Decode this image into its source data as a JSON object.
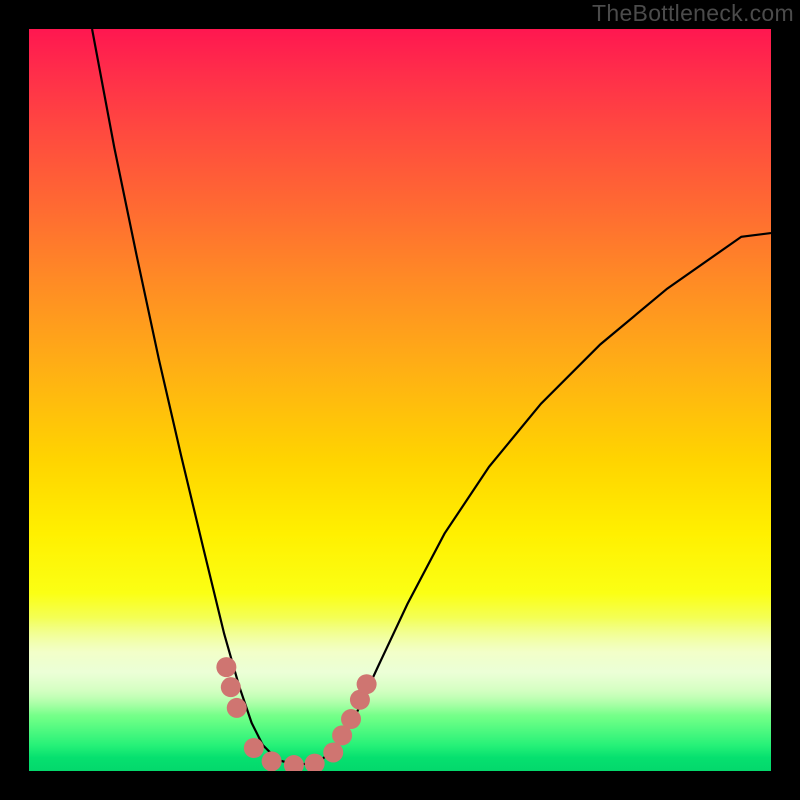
{
  "watermark": "TheBottleneck.com",
  "chart_data": {
    "type": "line",
    "title": "",
    "xlabel": "",
    "ylabel": "",
    "xlim": [
      0,
      1
    ],
    "ylim": [
      0,
      1
    ],
    "series": [
      {
        "name": "bottleneck-curve",
        "x": [
          0.085,
          0.115,
          0.145,
          0.175,
          0.205,
          0.235,
          0.263,
          0.283,
          0.3,
          0.315,
          0.335,
          0.36,
          0.39,
          0.41,
          0.44,
          0.47,
          0.51,
          0.56,
          0.62,
          0.69,
          0.77,
          0.86,
          0.96,
          1.0
        ],
        "y": [
          1.0,
          0.84,
          0.695,
          0.555,
          0.425,
          0.3,
          0.185,
          0.115,
          0.065,
          0.035,
          0.015,
          0.008,
          0.012,
          0.028,
          0.075,
          0.14,
          0.225,
          0.32,
          0.41,
          0.495,
          0.575,
          0.65,
          0.72,
          0.725
        ]
      }
    ],
    "markers": [
      {
        "x": 0.266,
        "y": 0.14
      },
      {
        "x": 0.272,
        "y": 0.113
      },
      {
        "x": 0.28,
        "y": 0.085
      },
      {
        "x": 0.303,
        "y": 0.031
      },
      {
        "x": 0.327,
        "y": 0.013
      },
      {
        "x": 0.357,
        "y": 0.008
      },
      {
        "x": 0.385,
        "y": 0.01
      },
      {
        "x": 0.41,
        "y": 0.025
      },
      {
        "x": 0.422,
        "y": 0.048
      },
      {
        "x": 0.434,
        "y": 0.07
      },
      {
        "x": 0.446,
        "y": 0.096
      },
      {
        "x": 0.455,
        "y": 0.117
      }
    ],
    "marker_color": "#cf7571",
    "curve_color": "#000000",
    "gradient_stops": [
      {
        "pos": 0.0,
        "color": "#ff1750"
      },
      {
        "pos": 0.58,
        "color": "#ffd400"
      },
      {
        "pos": 0.82,
        "color": "#fbff60"
      },
      {
        "pos": 1.0,
        "color": "#04d86c"
      }
    ]
  }
}
